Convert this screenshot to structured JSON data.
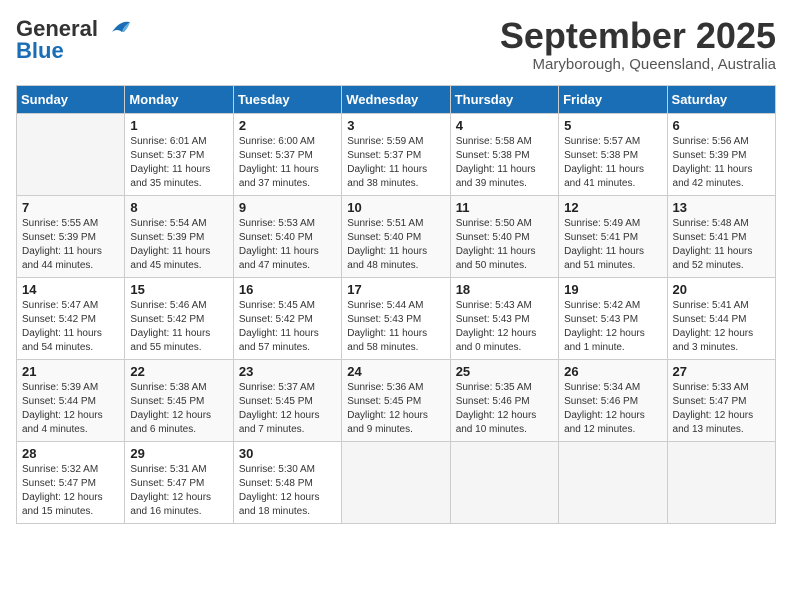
{
  "header": {
    "logo_general": "General",
    "logo_blue": "Blue",
    "month": "September 2025",
    "location": "Maryborough, Queensland, Australia"
  },
  "days_of_week": [
    "Sunday",
    "Monday",
    "Tuesday",
    "Wednesday",
    "Thursday",
    "Friday",
    "Saturday"
  ],
  "weeks": [
    [
      {
        "day": "",
        "sunrise": "",
        "sunset": "",
        "daylight": ""
      },
      {
        "day": "1",
        "sunrise": "Sunrise: 6:01 AM",
        "sunset": "Sunset: 5:37 PM",
        "daylight": "Daylight: 11 hours and 35 minutes."
      },
      {
        "day": "2",
        "sunrise": "Sunrise: 6:00 AM",
        "sunset": "Sunset: 5:37 PM",
        "daylight": "Daylight: 11 hours and 37 minutes."
      },
      {
        "day": "3",
        "sunrise": "Sunrise: 5:59 AM",
        "sunset": "Sunset: 5:37 PM",
        "daylight": "Daylight: 11 hours and 38 minutes."
      },
      {
        "day": "4",
        "sunrise": "Sunrise: 5:58 AM",
        "sunset": "Sunset: 5:38 PM",
        "daylight": "Daylight: 11 hours and 39 minutes."
      },
      {
        "day": "5",
        "sunrise": "Sunrise: 5:57 AM",
        "sunset": "Sunset: 5:38 PM",
        "daylight": "Daylight: 11 hours and 41 minutes."
      },
      {
        "day": "6",
        "sunrise": "Sunrise: 5:56 AM",
        "sunset": "Sunset: 5:39 PM",
        "daylight": "Daylight: 11 hours and 42 minutes."
      }
    ],
    [
      {
        "day": "7",
        "sunrise": "Sunrise: 5:55 AM",
        "sunset": "Sunset: 5:39 PM",
        "daylight": "Daylight: 11 hours and 44 minutes."
      },
      {
        "day": "8",
        "sunrise": "Sunrise: 5:54 AM",
        "sunset": "Sunset: 5:39 PM",
        "daylight": "Daylight: 11 hours and 45 minutes."
      },
      {
        "day": "9",
        "sunrise": "Sunrise: 5:53 AM",
        "sunset": "Sunset: 5:40 PM",
        "daylight": "Daylight: 11 hours and 47 minutes."
      },
      {
        "day": "10",
        "sunrise": "Sunrise: 5:51 AM",
        "sunset": "Sunset: 5:40 PM",
        "daylight": "Daylight: 11 hours and 48 minutes."
      },
      {
        "day": "11",
        "sunrise": "Sunrise: 5:50 AM",
        "sunset": "Sunset: 5:40 PM",
        "daylight": "Daylight: 11 hours and 50 minutes."
      },
      {
        "day": "12",
        "sunrise": "Sunrise: 5:49 AM",
        "sunset": "Sunset: 5:41 PM",
        "daylight": "Daylight: 11 hours and 51 minutes."
      },
      {
        "day": "13",
        "sunrise": "Sunrise: 5:48 AM",
        "sunset": "Sunset: 5:41 PM",
        "daylight": "Daylight: 11 hours and 52 minutes."
      }
    ],
    [
      {
        "day": "14",
        "sunrise": "Sunrise: 5:47 AM",
        "sunset": "Sunset: 5:42 PM",
        "daylight": "Daylight: 11 hours and 54 minutes."
      },
      {
        "day": "15",
        "sunrise": "Sunrise: 5:46 AM",
        "sunset": "Sunset: 5:42 PM",
        "daylight": "Daylight: 11 hours and 55 minutes."
      },
      {
        "day": "16",
        "sunrise": "Sunrise: 5:45 AM",
        "sunset": "Sunset: 5:42 PM",
        "daylight": "Daylight: 11 hours and 57 minutes."
      },
      {
        "day": "17",
        "sunrise": "Sunrise: 5:44 AM",
        "sunset": "Sunset: 5:43 PM",
        "daylight": "Daylight: 11 hours and 58 minutes."
      },
      {
        "day": "18",
        "sunrise": "Sunrise: 5:43 AM",
        "sunset": "Sunset: 5:43 PM",
        "daylight": "Daylight: 12 hours and 0 minutes."
      },
      {
        "day": "19",
        "sunrise": "Sunrise: 5:42 AM",
        "sunset": "Sunset: 5:43 PM",
        "daylight": "Daylight: 12 hours and 1 minute."
      },
      {
        "day": "20",
        "sunrise": "Sunrise: 5:41 AM",
        "sunset": "Sunset: 5:44 PM",
        "daylight": "Daylight: 12 hours and 3 minutes."
      }
    ],
    [
      {
        "day": "21",
        "sunrise": "Sunrise: 5:39 AM",
        "sunset": "Sunset: 5:44 PM",
        "daylight": "Daylight: 12 hours and 4 minutes."
      },
      {
        "day": "22",
        "sunrise": "Sunrise: 5:38 AM",
        "sunset": "Sunset: 5:45 PM",
        "daylight": "Daylight: 12 hours and 6 minutes."
      },
      {
        "day": "23",
        "sunrise": "Sunrise: 5:37 AM",
        "sunset": "Sunset: 5:45 PM",
        "daylight": "Daylight: 12 hours and 7 minutes."
      },
      {
        "day": "24",
        "sunrise": "Sunrise: 5:36 AM",
        "sunset": "Sunset: 5:45 PM",
        "daylight": "Daylight: 12 hours and 9 minutes."
      },
      {
        "day": "25",
        "sunrise": "Sunrise: 5:35 AM",
        "sunset": "Sunset: 5:46 PM",
        "daylight": "Daylight: 12 hours and 10 minutes."
      },
      {
        "day": "26",
        "sunrise": "Sunrise: 5:34 AM",
        "sunset": "Sunset: 5:46 PM",
        "daylight": "Daylight: 12 hours and 12 minutes."
      },
      {
        "day": "27",
        "sunrise": "Sunrise: 5:33 AM",
        "sunset": "Sunset: 5:47 PM",
        "daylight": "Daylight: 12 hours and 13 minutes."
      }
    ],
    [
      {
        "day": "28",
        "sunrise": "Sunrise: 5:32 AM",
        "sunset": "Sunset: 5:47 PM",
        "daylight": "Daylight: 12 hours and 15 minutes."
      },
      {
        "day": "29",
        "sunrise": "Sunrise: 5:31 AM",
        "sunset": "Sunset: 5:47 PM",
        "daylight": "Daylight: 12 hours and 16 minutes."
      },
      {
        "day": "30",
        "sunrise": "Sunrise: 5:30 AM",
        "sunset": "Sunset: 5:48 PM",
        "daylight": "Daylight: 12 hours and 18 minutes."
      },
      {
        "day": "",
        "sunrise": "",
        "sunset": "",
        "daylight": ""
      },
      {
        "day": "",
        "sunrise": "",
        "sunset": "",
        "daylight": ""
      },
      {
        "day": "",
        "sunrise": "",
        "sunset": "",
        "daylight": ""
      },
      {
        "day": "",
        "sunrise": "",
        "sunset": "",
        "daylight": ""
      }
    ]
  ]
}
